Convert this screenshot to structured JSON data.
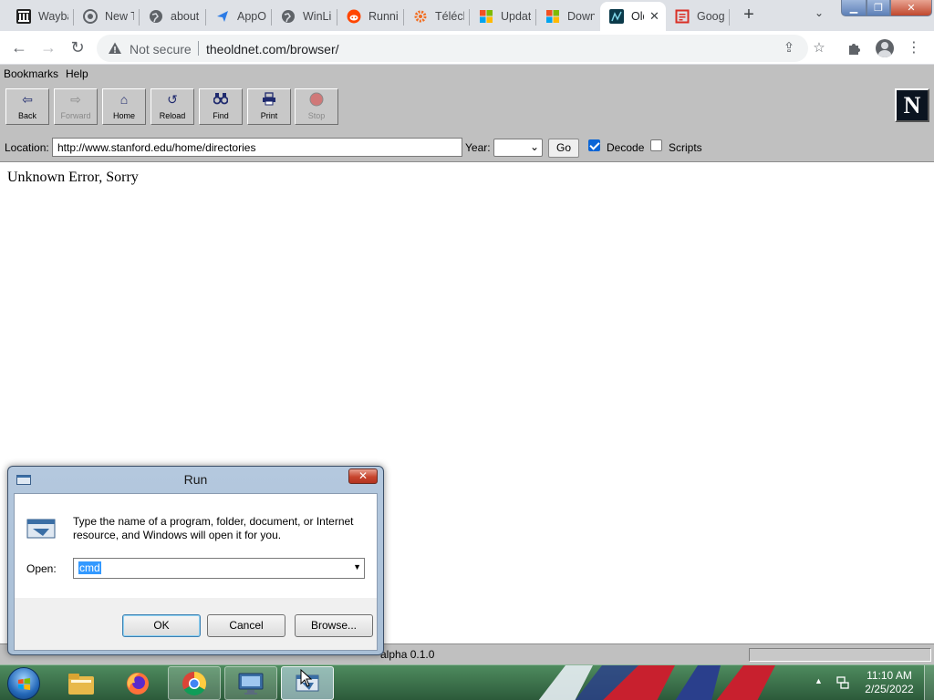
{
  "tabs": [
    {
      "label": "Wayback Machine",
      "icon": "wayback-icon",
      "active": false
    },
    {
      "label": "New Tab",
      "icon": "chrome-icon",
      "active": false
    },
    {
      "label": "about",
      "icon": "globe-icon",
      "active": false
    },
    {
      "label": "AppOnFly",
      "icon": "send-icon",
      "active": false
    },
    {
      "label": "WinLibre",
      "icon": "globe-icon",
      "active": false
    },
    {
      "label": "Running",
      "icon": "reddit-icon",
      "active": false
    },
    {
      "label": "Télécharger",
      "icon": "gear-icon",
      "active": false
    },
    {
      "label": "Update",
      "icon": "microsoft-icon",
      "active": false
    },
    {
      "label": "Download",
      "icon": "microsoft-icon",
      "active": false
    },
    {
      "label": "OldNet",
      "icon": "oldnet-icon",
      "active": true
    },
    {
      "label": "Google",
      "icon": "doc-icon",
      "active": false
    }
  ],
  "address_bar": {
    "security_label": "Not secure",
    "url": "theoldnet.com/browser/"
  },
  "oldnet": {
    "menu": {
      "bookmarks": "Bookmarks",
      "help": "Help"
    },
    "toolbar": {
      "back": "Back",
      "forward": "Forward",
      "home": "Home",
      "reload": "Reload",
      "find": "Find",
      "print": "Print",
      "stop": "Stop"
    },
    "logo_letter": "N",
    "location_label": "Location:",
    "location_value": "http://www.stanford.edu/home/directories",
    "year_label": "Year:",
    "year_value": "",
    "go_label": "Go",
    "decode_label": "Decode",
    "decode_checked": true,
    "scripts_label": "Scripts",
    "scripts_checked": false,
    "error_message": "Unknown Error, Sorry",
    "status_text": "alpha 0.1.0"
  },
  "run_dialog": {
    "title": "Run",
    "description": "Type the name of a program, folder, document, or Internet resource, and Windows will open it for you.",
    "open_label": "Open:",
    "open_value": "cmd",
    "ok_label": "OK",
    "cancel_label": "Cancel",
    "browse_label": "Browse..."
  },
  "taskbar": {
    "apps": [
      "file-explorer-icon",
      "firefox-icon",
      "chrome-icon",
      "remote-desktop-icon",
      "run-dialog-icon"
    ],
    "clock_time": "11:10 AM",
    "clock_date": "2/25/2022"
  },
  "colors": {
    "oldnet_gray": "#c0c0c0",
    "selection_blue": "#3399ff",
    "taskbar_green": "#2c5a3a"
  }
}
